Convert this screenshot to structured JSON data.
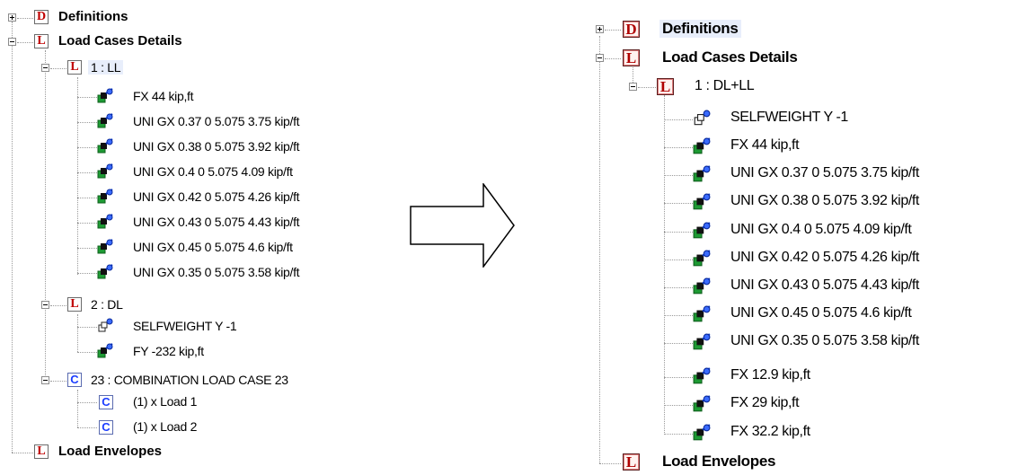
{
  "left_tree": {
    "definitions": "Definitions",
    "load_cases_details": "Load Cases Details",
    "case1": "1 : LL",
    "case1_loads": [
      "FX 44 kip,ft",
      "UNI GX 0.37 0 5.075 3.75 kip/ft",
      "UNI GX 0.38 0 5.075 3.92 kip/ft",
      "UNI GX 0.4 0 5.075 4.09 kip/ft",
      "UNI GX 0.42 0 5.075 4.26 kip/ft",
      "UNI GX 0.43 0 5.075 4.43 kip/ft",
      "UNI GX 0.45 0 5.075 4.6 kip/ft",
      "UNI GX 0.35 0 5.075 3.58 kip/ft"
    ],
    "case2": "2 : DL",
    "case2_loads": [
      "SELFWEIGHT Y -1",
      "FY -232 kip,ft"
    ],
    "case23": "23 : COMBINATION LOAD CASE 23",
    "case23_items": [
      "(1) x Load 1",
      "(1) x Load 2"
    ],
    "load_envelopes": "Load Envelopes"
  },
  "right_tree": {
    "definitions": "Definitions",
    "load_cases_details": "Load Cases Details",
    "case1": "1 : DL+LL",
    "case1_loads": [
      "SELFWEIGHT Y -1",
      "FX 44 kip,ft",
      "UNI GX 0.37 0 5.075 3.75 kip/ft",
      "UNI GX 0.38 0 5.075 3.92 kip/ft",
      "UNI GX 0.4 0 5.075 4.09 kip/ft",
      "UNI GX 0.42 0 5.075 4.26 kip/ft",
      "UNI GX 0.43 0 5.075 4.43 kip/ft",
      "UNI GX 0.45 0 5.075 4.6 kip/ft",
      "UNI GX 0.35 0 5.075 3.58 kip/ft",
      "FX 12.9 kip,ft",
      "FX 29 kip,ft",
      "FX 32.2 kip,ft"
    ],
    "load_envelopes": "Load Envelopes"
  },
  "icons": {
    "definitions": "D",
    "load": "L",
    "combination": "C"
  },
  "colors": {
    "load_icon_red": "#c00000",
    "combination_icon_blue": "#1a3cff",
    "selection_highlight": "#e8eefb"
  }
}
